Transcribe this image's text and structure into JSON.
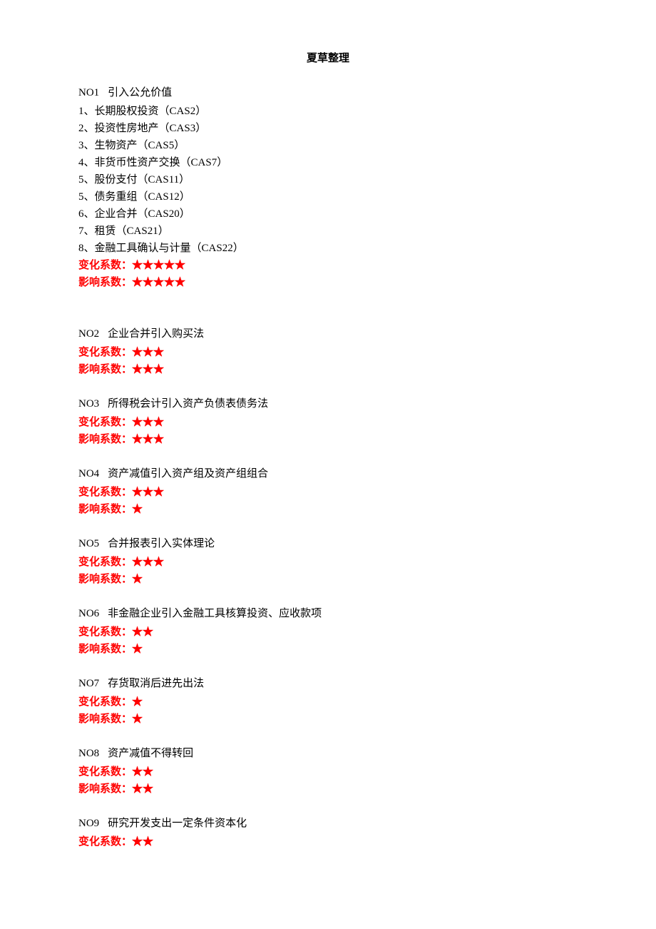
{
  "title": "夏草整理",
  "labels": {
    "change": "变化系数：",
    "impact": "影响系数："
  },
  "sections": [
    {
      "no": "NO1",
      "heading": "引入公允价值",
      "items": [
        {
          "num": "1、",
          "text": "长期股权投资",
          "code": "（CAS2）"
        },
        {
          "num": "2、",
          "text": "投资性房地产",
          "code": "（CAS3）"
        },
        {
          "num": "3、",
          "text": "生物资产",
          "code": "（CAS5）"
        },
        {
          "num": "4、",
          "text": "非货币性资产交换",
          "code": "（CAS7）"
        },
        {
          "num": "5、",
          "text": "股份支付",
          "code": "（CAS11）"
        },
        {
          "num": "5、",
          "text": "债务重组",
          "code": "（CAS12）"
        },
        {
          "num": "6、",
          "text": "企业合并",
          "code": "（CAS20）"
        },
        {
          "num": "7、",
          "text": "租赁",
          "code": "（CAS21）"
        },
        {
          "num": "8、",
          "text": "金融工具确认与计量",
          "code": "（CAS22）"
        }
      ],
      "change_stars": "★★★★★",
      "impact_stars": "★★★★★",
      "extra_gap": true
    },
    {
      "no": "NO2",
      "heading": "企业合并引入购买法",
      "items": [],
      "change_stars": "★★★",
      "impact_stars": "★★★"
    },
    {
      "no": "NO3",
      "heading": "所得税会计引入资产负债表债务法",
      "items": [],
      "change_stars": "★★★",
      "impact_stars": "★★★"
    },
    {
      "no": "NO4",
      "heading": "资产减值引入资产组及资产组组合",
      "items": [],
      "change_stars": "★★★",
      "impact_stars": "★"
    },
    {
      "no": "NO5",
      "heading": "合并报表引入实体理论",
      "items": [],
      "change_stars": "★★★",
      "impact_stars": "★"
    },
    {
      "no": "NO6",
      "heading": "非金融企业引入金融工具核算投资、应收款项",
      "items": [],
      "change_stars": "★★",
      "impact_stars": "★"
    },
    {
      "no": "NO7",
      "heading": "存货取消后进先出法",
      "items": [],
      "change_stars": "★",
      "impact_stars": "★"
    },
    {
      "no": "NO8",
      "heading": "资产减值不得转回",
      "items": [],
      "change_stars": "★★",
      "impact_stars": "★★"
    },
    {
      "no": "NO9",
      "heading": "研究开发支出一定条件资本化",
      "items": [],
      "change_stars": "★★",
      "impact_stars": null
    }
  ]
}
